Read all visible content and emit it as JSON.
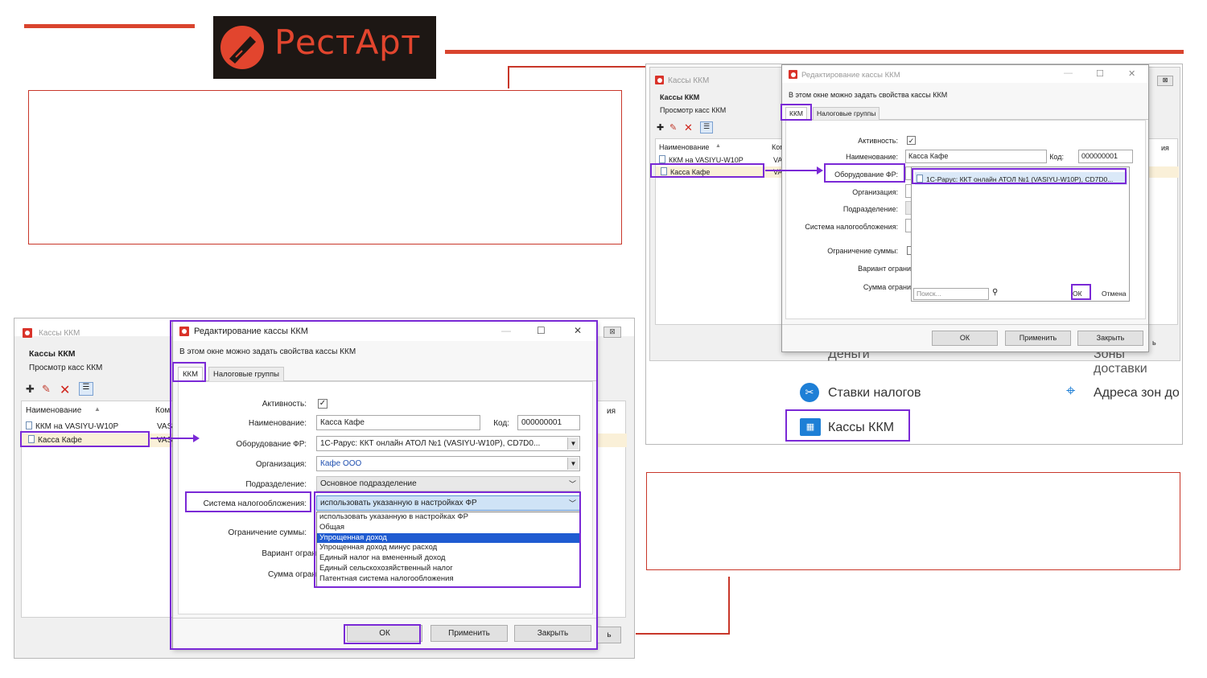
{
  "logo": {
    "text": "РестАрт"
  },
  "colors": {
    "accent_red": "#d9442e",
    "highlight_purple": "#7a29d6",
    "selection_blue": "#1f5bd1"
  },
  "left": {
    "bg_window": {
      "title": "Кассы ККМ",
      "heading": "Кассы ККМ",
      "subheading": "Просмотр касс ККМ",
      "col_name": "Наименование",
      "col_partial": "Ком",
      "rows": [
        "ККМ на VASIYU-W10P",
        "Касса Кафе"
      ],
      "row_partial": [
        "VAS",
        "VAS"
      ],
      "close_partial": "⊠",
      "behind_partial": "ия"
    },
    "dialog": {
      "title": "Редактирование кассы ККМ",
      "hint": "В этом окне можно задать свойства кассы ККМ",
      "tabs": [
        "ККМ",
        "Налоговые группы"
      ],
      "labels": {
        "active": "Активность:",
        "name": "Наименование:",
        "code": "Код:",
        "equipment": "Оборудование ФР:",
        "org": "Организация:",
        "division": "Подразделение:",
        "tax_system": "Система налогообложения:",
        "limit": "Ограничение суммы:",
        "variant": "Вариант огран",
        "sum": "Сумма огран"
      },
      "values": {
        "name": "Касса Кафе",
        "code": "000000001",
        "equipment": "1С-Рарус: ККТ онлайн АТОЛ №1 (VASIYU-W10P), CD7D0...",
        "org": "Кафе ООО",
        "division": "Основное подразделение",
        "tax_system": "использовать указанную в настройках ФР"
      },
      "tax_options": [
        "использовать указанную в настройках ФР",
        "Общая",
        "Упрощенная доход",
        "Упрощенная доход минус расход",
        "Единый налог на вмененный доход",
        "Единый сельскохозяйственный налог",
        "Патентная система налогообложения"
      ],
      "selected_option_index": 2,
      "buttons": {
        "ok": "ОК",
        "apply": "Применить",
        "close": "Закрыть"
      }
    }
  },
  "right": {
    "bg_window": {
      "title": "Кассы ККМ",
      "heading": "Кассы ККМ",
      "subheading": "Просмотр касс ККМ",
      "col_name": "Наименование",
      "col_partial": "Ком",
      "rows": [
        "ККМ на VASIYU-W10P",
        "Касса Кафе"
      ],
      "row_partial": [
        "VAS",
        "VAS"
      ],
      "behind_partial": "ия",
      "close_tail": "ь"
    },
    "dialog": {
      "title": "Редактирование кассы ККМ",
      "hint": "В этом окне можно задать свойства кассы ККМ",
      "tabs": [
        "ККМ",
        "Налоговые группы"
      ],
      "labels": {
        "active": "Активность:",
        "name": "Наименование:",
        "code": "Код:",
        "equipment": "Оборудование ФР:",
        "org": "Организация:",
        "division": "Подразделение:",
        "tax_system": "Система налогообложения:",
        "limit": "Ограничение суммы:",
        "variant": "Вариант ограни",
        "sum": "Сумма ограни"
      },
      "values": {
        "name": "Касса Кафе",
        "code": "000000001"
      },
      "picker": {
        "item": "1С-Рарус: ККТ онлайн АТОЛ №1 (VASIYU-W10P), CD7D0...",
        "search_placeholder": "Поиск...",
        "ok": "ОК",
        "cancel": "Отмена"
      },
      "buttons": {
        "ok": "ОК",
        "apply": "Применить",
        "close": "Закрыть"
      }
    },
    "menu": {
      "money_partial": "Деньги",
      "zones_partial": "Зоны доставки",
      "tax_rates": "Ставки налогов",
      "zone_addresses": "Адреса зон до",
      "kkm": "Кассы ККМ"
    }
  }
}
